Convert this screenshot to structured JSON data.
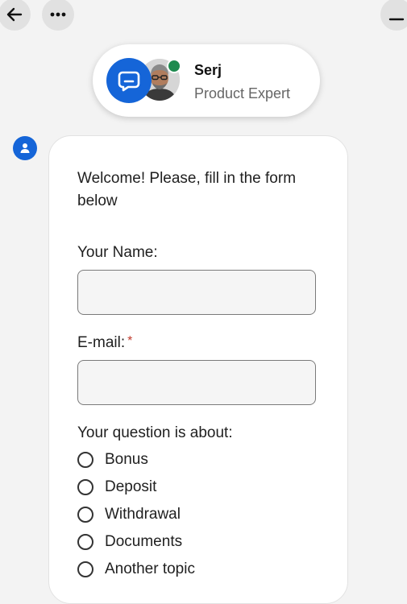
{
  "agent": {
    "name": "Serj",
    "role": "Product Expert"
  },
  "form": {
    "welcome": "Welcome! Please, fill in the form below",
    "name_label": "Your Name:",
    "name_value": "",
    "email_label": "E-mail:",
    "email_required_mark": "*",
    "email_value": "",
    "topic_label": "Your question is about:",
    "topics": [
      "Bonus",
      "Deposit",
      "Withdrawal",
      "Documents",
      "Another topic"
    ]
  },
  "colors": {
    "accent": "#1565d8",
    "online": "#1e8a4f",
    "required": "#c0392b"
  },
  "icons": {
    "back": "arrow-left-icon",
    "more": "more-horizontal-icon",
    "minimize": "minimize-icon",
    "chat": "chat-bubble-icon",
    "bot": "user-icon"
  }
}
